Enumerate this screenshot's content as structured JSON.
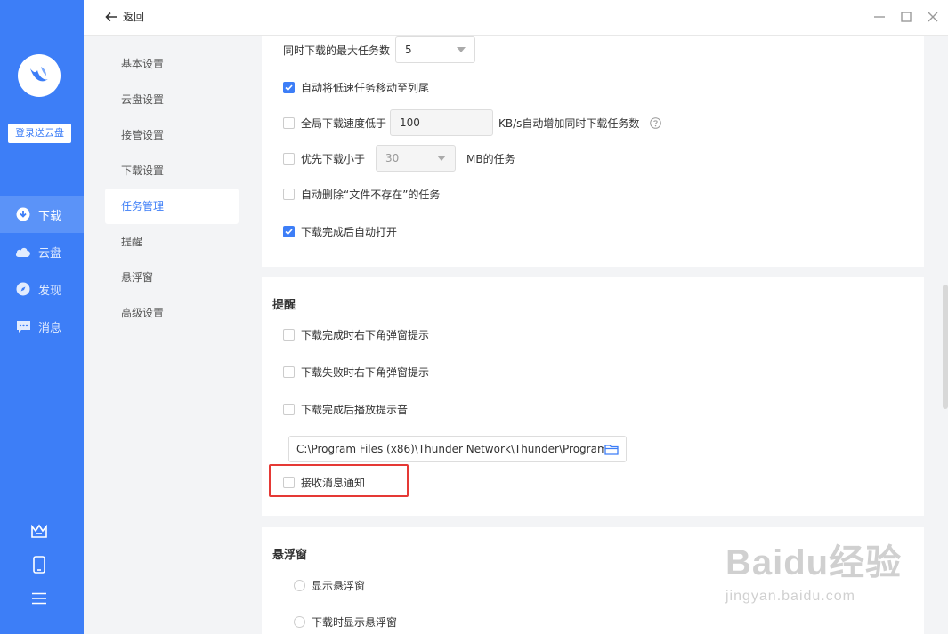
{
  "app": {
    "login_button": "登录送云盘",
    "nav": [
      {
        "label": "下载",
        "icon": "download-icon"
      },
      {
        "label": "云盘",
        "icon": "cloud-icon"
      },
      {
        "label": "发现",
        "icon": "compass-icon"
      },
      {
        "label": "消息",
        "icon": "message-icon"
      }
    ],
    "bottom_icons": [
      "crown-icon",
      "phone-icon",
      "menu-icon"
    ],
    "accent_color": "#3d7ef7"
  },
  "titlebar": {
    "back_label": "返回"
  },
  "settings_nav": [
    {
      "label": "基本设置"
    },
    {
      "label": "云盘设置"
    },
    {
      "label": "接管设置"
    },
    {
      "label": "下载设置"
    },
    {
      "label": "任务管理"
    },
    {
      "label": "提醒"
    },
    {
      "label": "悬浮窗"
    },
    {
      "label": "高级设置"
    }
  ],
  "task_mgmt": {
    "max_tasks_label": "同时下载的最大任务数",
    "max_tasks_value": "5",
    "move_slow_label": "自动将低速任务移动至列尾",
    "move_slow_checked": true,
    "speed_prefix": "全局下载速度低于",
    "speed_value": "100",
    "speed_suffix": "KB/s自动增加同时下载任务数",
    "speed_checked": false,
    "priority_prefix": "优先下载小于",
    "priority_value": "30",
    "priority_suffix": "MB的任务",
    "priority_checked": false,
    "auto_delete_label": "自动删除“文件不存在”的任务",
    "auto_delete_checked": false,
    "auto_open_label": "下载完成后自动打开",
    "auto_open_checked": true
  },
  "reminder": {
    "title": "提醒",
    "items": [
      {
        "label": "下载完成时右下角弹窗提示",
        "checked": false
      },
      {
        "label": "下载失败时右下角弹窗提示",
        "checked": false
      },
      {
        "label": "下载完成后播放提示音",
        "checked": false
      }
    ],
    "sound_path": "C:\\Program Files (x86)\\Thunder Network\\Thunder\\Program",
    "receive_msg_label": "接收消息通知",
    "receive_msg_checked": false
  },
  "floating": {
    "title": "悬浮窗",
    "items": [
      {
        "label": "显示悬浮窗"
      },
      {
        "label": "下载时显示悬浮窗"
      }
    ]
  },
  "watermark": {
    "main": "Baidu经验",
    "sub": "jingyan.baidu.com"
  }
}
